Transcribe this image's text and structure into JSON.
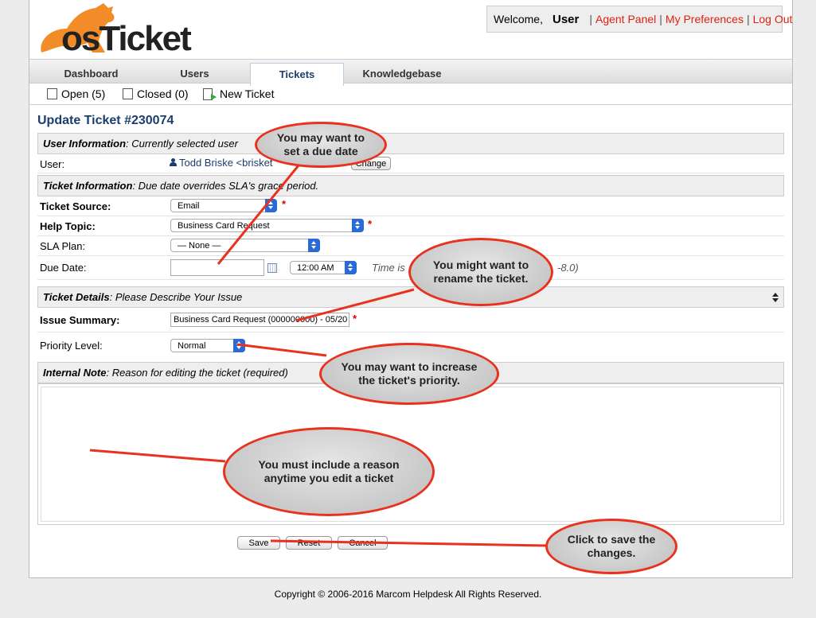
{
  "header": {
    "logo_text": "osTicket",
    "welcome": "Welcome,",
    "username": "User",
    "links": [
      "Agent Panel",
      "My Preferences",
      "Log Out"
    ]
  },
  "nav": {
    "tabs": [
      "Dashboard",
      "Users",
      "Tickets",
      "Knowledgebase"
    ],
    "active": "Tickets"
  },
  "subnav": {
    "open": "Open (5)",
    "closed": "Closed (0)",
    "new_ticket": "New Ticket"
  },
  "form": {
    "title": "Update Ticket #230074",
    "user_section_title": "User Information",
    "user_section_desc": ": Currently selected user",
    "user_label": "User:",
    "user_value": "Todd Briske <brisket",
    "change_button": "Change",
    "ticket_section_title": "Ticket Information",
    "ticket_section_desc": ": Due date overrides SLA's grace period.",
    "source_label": "Ticket Source:",
    "source_value": "Email",
    "help_topic_label": "Help Topic:",
    "help_topic_value": "Business Card Request",
    "sla_label": "SLA Plan:",
    "sla_value": "— None —",
    "due_label": "Due Date:",
    "due_value": "",
    "time_value": "12:00 AM",
    "time_note": "Time is",
    "time_note_tail": "-8.0)",
    "details_section_title": "Ticket Details",
    "details_section_desc": ": Please Describe Your Issue",
    "summary_label": "Issue Summary:",
    "summary_value": "Business Card Request (000000000) - 05/20",
    "priority_label": "Priority Level:",
    "priority_value": "Normal",
    "note_section_title": "Internal Note",
    "note_section_desc": ": Reason for editing the ticket (required)",
    "note_value": "",
    "save_label": "Save",
    "reset_label": "Reset",
    "cancel_label": "Cancel"
  },
  "callouts": {
    "due_date": "You may want to set a due date",
    "rename": "You might want to rename the ticket.",
    "priority": "You may want to increase the ticket's priority.",
    "reason": "You must include a reason anytime you edit a ticket",
    "save": "Click to save the changes."
  },
  "footer": "Copyright © 2006-2016 Marcom Helpdesk All Rights Reserved.",
  "colors": {
    "accent_link": "#dd2211",
    "title_blue": "#1a3e6e",
    "callout_border": "#e8321e",
    "logo_orange": "#f28c28"
  }
}
